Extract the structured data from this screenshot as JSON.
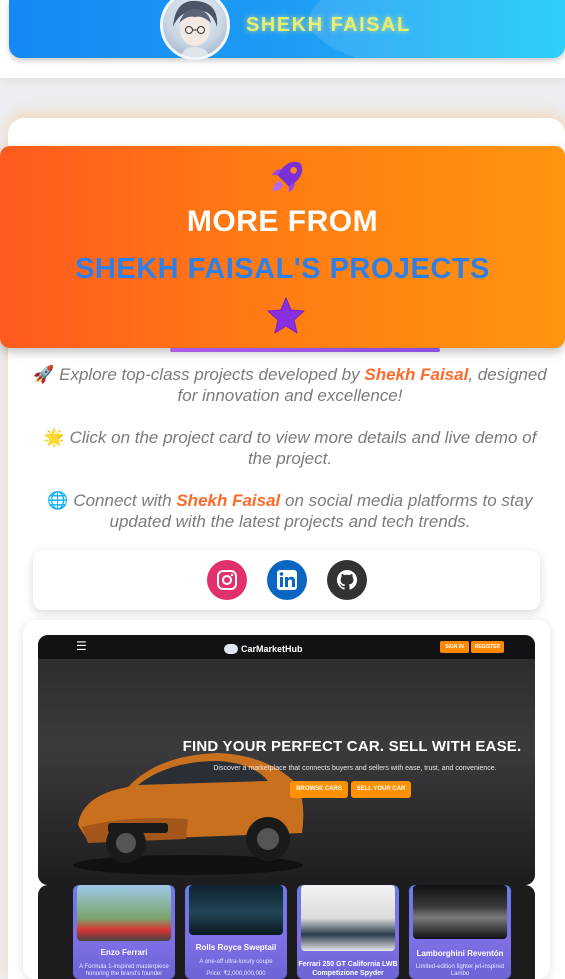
{
  "header": {
    "title": "SHEKH FAISAL",
    "avatar": "avatar"
  },
  "hero": {
    "icon_top": "rocket-icon",
    "line1": "MORE FROM",
    "line2": "SHEKH FAISAL'S PROJECTS",
    "icon_bottom": "star-icon"
  },
  "intro": {
    "p1_emoji": "🚀",
    "p1_pre": "Explore top-class projects developed by",
    "p1_name": "Shekh Faisal",
    "p1_post": ", designed for innovation and excellence!",
    "p2_emoji": "🌟",
    "p2_text": "Click on the project card to view more details and live demo of the project.",
    "p3_emoji": "🌐",
    "p3_pre": "Connect with",
    "p3_name": "Shekh Faisal",
    "p3_post": "on social media platforms to stay updated with the latest projects and tech trends."
  },
  "social": {
    "links": [
      {
        "name": "instagram",
        "icon": "instagram-icon",
        "color": "#e1306c"
      },
      {
        "name": "linkedin",
        "icon": "linkedin-icon",
        "color": "#0a66c2"
      },
      {
        "name": "github",
        "icon": "github-icon",
        "color": "#333333"
      }
    ]
  },
  "project": {
    "nav": {
      "brand": "CarMarketHub",
      "signin": "SIGN IN",
      "register": "REGISTER"
    },
    "headline": "FIND YOUR PERFECT CAR. SELL WITH EASE.",
    "subline": "Discover a marketplace that connects buyers and sellers with ease, trust, and convenience.",
    "btn_browse": "BROWSE CARS",
    "btn_sell": "SELL YOUR CAR",
    "cars": [
      {
        "name": "Enzo Ferrari",
        "desc": "A Formula 1-inspired masterpiece honoring the brand's founder"
      },
      {
        "name": "Rolls Royce Sweptail",
        "desc": "A one-off ultra-luxury coupe",
        "price": "Price: ₹2,000,000,000"
      },
      {
        "name": "Ferrari 250 GT California LWB Competizione Spyder",
        "desc": ""
      },
      {
        "name": "Lamborghini Reventón",
        "desc": "Limited-edition fighter jet-inspired Lambo"
      }
    ]
  },
  "colors": {
    "accent_orange": "#ff7a12",
    "title_blue": "#2f7fe8",
    "highlight": "#ff6a2a",
    "banner_blue": "#1e9ef5"
  }
}
